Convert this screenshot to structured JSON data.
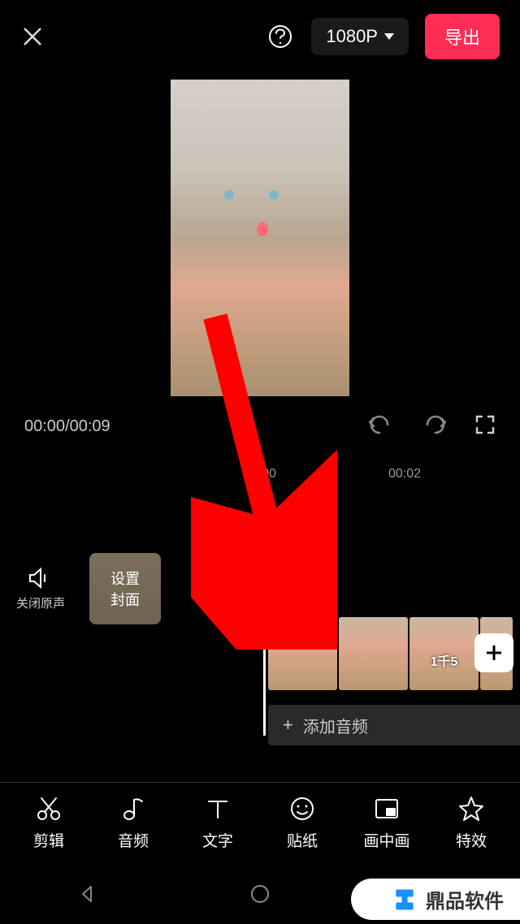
{
  "top": {
    "resolution": "1080P",
    "export_label": "导出"
  },
  "time": {
    "current": "00:00",
    "total": "00:09"
  },
  "ruler": {
    "t0": "00:00",
    "t1": "00:02"
  },
  "mute": {
    "label": "关闭原声"
  },
  "cover": {
    "line1": "设置",
    "line2": "封面"
  },
  "clips": {
    "overlay_text": "1千5"
  },
  "audio": {
    "label": "添加音频",
    "plus": "+"
  },
  "tools": {
    "cut": "剪辑",
    "audio": "音频",
    "text": "文字",
    "sticker": "贴纸",
    "pip": "画中画",
    "effect": "特效"
  },
  "watermark": {
    "text": "鼎品软件"
  }
}
